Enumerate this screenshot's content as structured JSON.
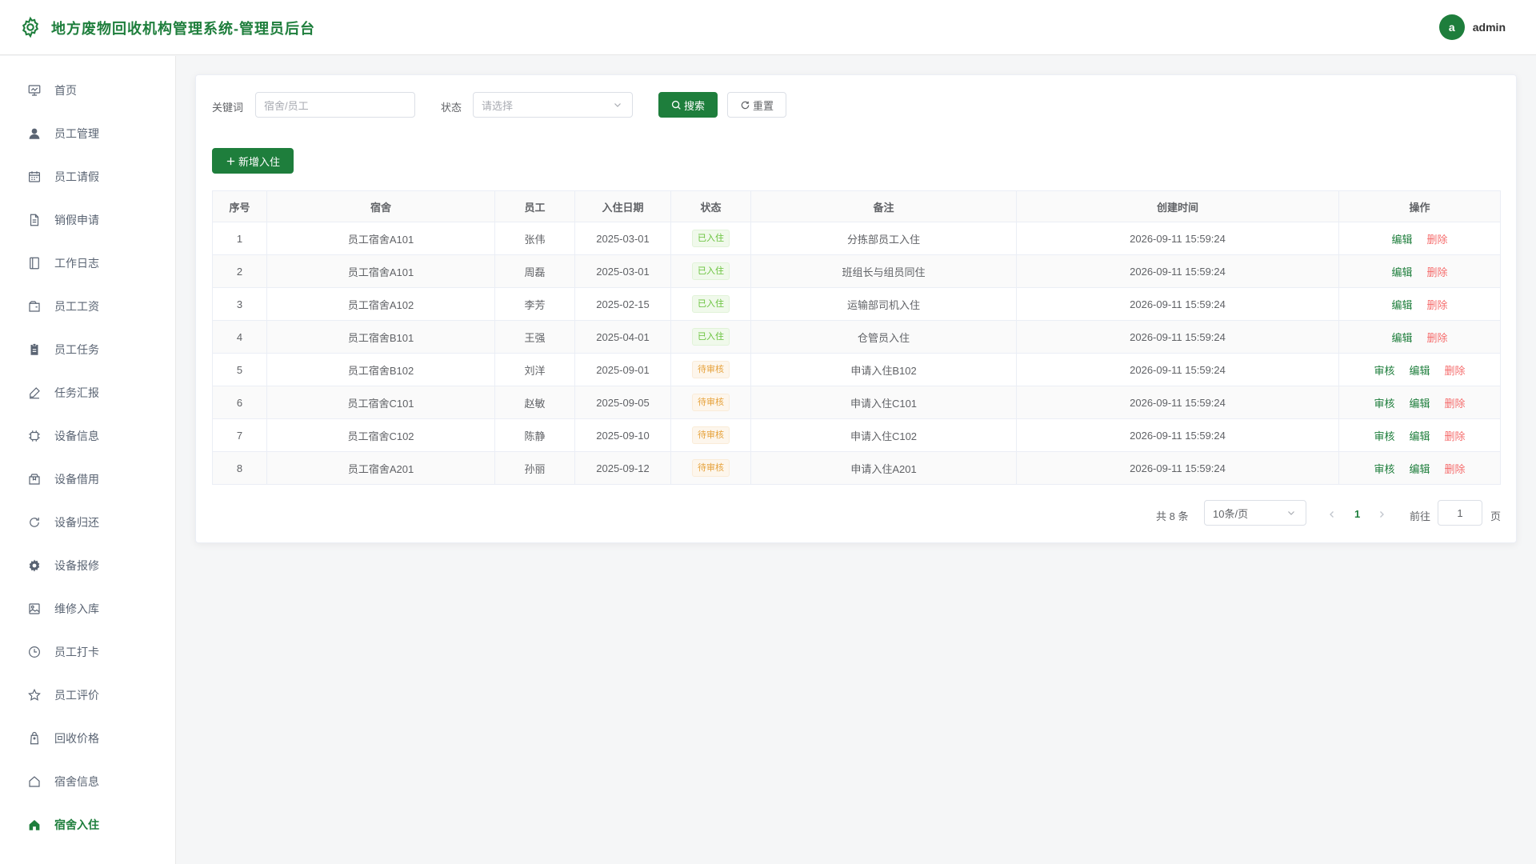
{
  "header": {
    "title": "地方废物回收机构管理系统-管理员后台",
    "avatar_letter": "a",
    "username": "admin"
  },
  "sidebar": {
    "items": [
      {
        "label": "首页",
        "icon": "monitor-icon"
      },
      {
        "label": "员工管理",
        "icon": "user-icon"
      },
      {
        "label": "员工请假",
        "icon": "calendar-icon"
      },
      {
        "label": "销假申请",
        "icon": "document-icon"
      },
      {
        "label": "工作日志",
        "icon": "notebook-icon"
      },
      {
        "label": "员工工资",
        "icon": "wallet-icon"
      },
      {
        "label": "员工任务",
        "icon": "clipboard-icon"
      },
      {
        "label": "任务汇报",
        "icon": "edit-pen-icon"
      },
      {
        "label": "设备信息",
        "icon": "cpu-icon"
      },
      {
        "label": "设备借用",
        "icon": "box-icon"
      },
      {
        "label": "设备归还",
        "icon": "refresh-icon"
      },
      {
        "label": "设备报修",
        "icon": "settings-icon"
      },
      {
        "label": "维修入库",
        "icon": "picture-icon"
      },
      {
        "label": "员工打卡",
        "icon": "clock-icon"
      },
      {
        "label": "员工评价",
        "icon": "star-icon"
      },
      {
        "label": "回收价格",
        "icon": "price-tag-icon"
      },
      {
        "label": "宿舍信息",
        "icon": "house-icon"
      },
      {
        "label": "宿舍入住",
        "icon": "house-filled-icon",
        "active": true
      }
    ]
  },
  "search": {
    "keyword_label": "关键词",
    "keyword_placeholder": "宿舍/员工",
    "status_label": "状态",
    "status_placeholder": "请选择",
    "search_button": "搜索",
    "reset_button": "重置"
  },
  "add_button": "新增入住",
  "table": {
    "columns": [
      "序号",
      "宿舍",
      "员工",
      "入住日期",
      "状态",
      "备注",
      "创建时间",
      "操作"
    ],
    "rows": [
      {
        "no": "1",
        "dorm": "员工宿舍A101",
        "employee": "张伟",
        "date": "2025-03-01",
        "status": "已入住",
        "status_type": "green",
        "remark": "分拣部员工入住",
        "created": "2026-09-11 15:59:24",
        "actions": [
          "编辑",
          "删除"
        ]
      },
      {
        "no": "2",
        "dorm": "员工宿舍A101",
        "employee": "周磊",
        "date": "2025-03-01",
        "status": "已入住",
        "status_type": "green",
        "remark": "班组长与组员同住",
        "created": "2026-09-11 15:59:24",
        "actions": [
          "编辑",
          "删除"
        ]
      },
      {
        "no": "3",
        "dorm": "员工宿舍A102",
        "employee": "李芳",
        "date": "2025-02-15",
        "status": "已入住",
        "status_type": "green",
        "remark": "运输部司机入住",
        "created": "2026-09-11 15:59:24",
        "actions": [
          "编辑",
          "删除"
        ]
      },
      {
        "no": "4",
        "dorm": "员工宿舍B101",
        "employee": "王强",
        "date": "2025-04-01",
        "status": "已入住",
        "status_type": "green",
        "remark": "仓管员入住",
        "created": "2026-09-11 15:59:24",
        "actions": [
          "编辑",
          "删除"
        ]
      },
      {
        "no": "5",
        "dorm": "员工宿舍B102",
        "employee": "刘洋",
        "date": "2025-09-01",
        "status": "待审核",
        "status_type": "orange",
        "remark": "申请入住B102",
        "created": "2026-09-11 15:59:24",
        "actions": [
          "审核",
          "编辑",
          "删除"
        ]
      },
      {
        "no": "6",
        "dorm": "员工宿舍C101",
        "employee": "赵敏",
        "date": "2025-09-05",
        "status": "待审核",
        "status_type": "orange",
        "remark": "申请入住C101",
        "created": "2026-09-11 15:59:24",
        "actions": [
          "审核",
          "编辑",
          "删除"
        ]
      },
      {
        "no": "7",
        "dorm": "员工宿舍C102",
        "employee": "陈静",
        "date": "2025-09-10",
        "status": "待审核",
        "status_type": "orange",
        "remark": "申请入住C102",
        "created": "2026-09-11 15:59:24",
        "actions": [
          "审核",
          "编辑",
          "删除"
        ]
      },
      {
        "no": "8",
        "dorm": "员工宿舍A201",
        "employee": "孙丽",
        "date": "2025-09-12",
        "status": "待审核",
        "status_type": "orange",
        "remark": "申请入住A201",
        "created": "2026-09-11 15:59:24",
        "actions": [
          "审核",
          "编辑",
          "删除"
        ]
      }
    ]
  },
  "pagination": {
    "total_text": "共 8 条",
    "page_size": "10条/页",
    "current_page": "1",
    "goto_label": "前往",
    "goto_value": "1",
    "page_suffix": "页"
  },
  "colors": {
    "primary": "#1e7e3c",
    "danger": "#f56c6c",
    "tag_green": "#67c23a",
    "tag_orange": "#e6a23c"
  }
}
